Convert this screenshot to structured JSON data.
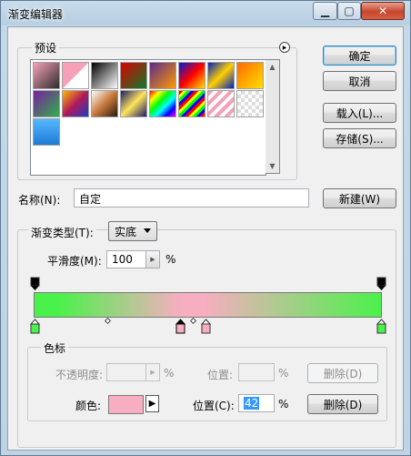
{
  "window": {
    "title": "渐变编辑器"
  },
  "presets": {
    "label": "预设",
    "swatches": [
      {
        "bg": "linear-gradient(135deg,#f7a1b8,#2c2c2c)"
      },
      {
        "bg": "linear-gradient(135deg,#f7a1b8 50%,#fff 50%)"
      },
      {
        "bg": "linear-gradient(135deg,#000,#fff)"
      },
      {
        "bg": "linear-gradient(135deg,#e00000,#0b7a2a)"
      },
      {
        "bg": "linear-gradient(135deg,#5a2a8c,#ff9a00)"
      },
      {
        "bg": "linear-gradient(135deg,#0018d0,#ff0000,#ffe000)"
      },
      {
        "bg": "linear-gradient(135deg,#0020c0,#ffd000,#0020c0)"
      },
      {
        "bg": "linear-gradient(135deg,#ff6a00,#ffe000)"
      },
      {
        "bg": "linear-gradient(135deg,#7a1ea0,#2fb04a)"
      },
      {
        "bg": "linear-gradient(135deg,#ffb800,#b01a5a,#1a3cc8)"
      },
      {
        "bg": "linear-gradient(135deg,#fff,#c8783c,#2a1a10)"
      },
      {
        "bg": "linear-gradient(135deg,#1a1a6a,#ffe45a,#1a1a6a)"
      },
      {
        "bg": "linear-gradient(135deg,#ff0000,#ffff00,#00ff00,#00ffff,#0000ff,#ff00ff)"
      },
      {
        "bg": "repeating-linear-gradient(135deg,#f00 0 3px,#ff0 3px 6px,#0f0 6px 9px,#00f 9px 12px)"
      },
      {
        "bg": "repeating-linear-gradient(135deg,#f4a0b6 0 4px,#fff 4px 8px)"
      },
      {
        "bg": "repeating-conic-gradient(#ddd 0 25%,#fff 0 50%) 0 0/8px 8px"
      },
      {
        "bg": "linear-gradient(180deg,#56b8ff,#1e7ad6)"
      }
    ],
    "menu_icon": "triangle-right-icon"
  },
  "buttons": {
    "ok": "确定",
    "cancel": "取消",
    "load": "载入(L)...",
    "save": "存储(S)...",
    "new": "新建(W)",
    "delete_opacity": "删除(D)",
    "delete_color": "删除(D)"
  },
  "name": {
    "label": "名称(N):",
    "value": "自定"
  },
  "gradient": {
    "type_label": "渐变类型(T):",
    "type_value": "实底",
    "smoothness_label": "平滑度(M):",
    "smoothness_value": "100",
    "smoothness_unit": "%",
    "colors": {
      "left": "#4bf14b",
      "middle": "#f6aec0",
      "right": "#4bf14b"
    }
  },
  "stops": {
    "label": "色标",
    "opacity_label": "不透明度:",
    "opacity_value": "",
    "opacity_unit": "%",
    "opacity_position_label": "位置:",
    "opacity_position_value": "",
    "opacity_position_unit": "%",
    "color_label": "颜色:",
    "color_value": "#f6aec0",
    "color_position_label": "位置(C):",
    "color_position_value": "42",
    "color_position_unit": "%"
  }
}
